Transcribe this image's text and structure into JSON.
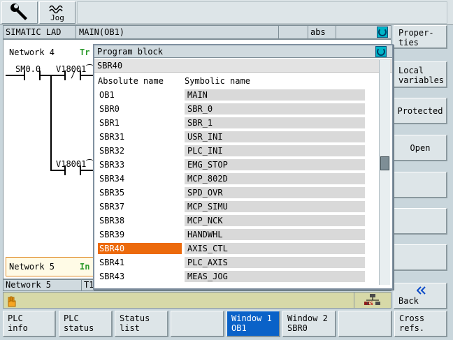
{
  "toolbar": {
    "tools_icon": "wrench-icon",
    "jog_icon": "jog-wave-icon",
    "jog_label": "Jog"
  },
  "header": {
    "left": "SIMATIC LAD",
    "program": "MAIN(OB1)",
    "mode": "abs"
  },
  "ladder": {
    "network4_label": "Network 4",
    "network4_trail": "Tr",
    "contact1": "SM0.0",
    "contact2": "V18001⁀",
    "contact3": "V18001⁀",
    "network5_label": "Network 5",
    "network5_trail": "In",
    "status_network": "Network 5",
    "status_trail": "T1"
  },
  "dialog": {
    "title": "Program block",
    "current": "SBR40",
    "col_absolute": "Absolute name",
    "col_symbolic": "Symbolic name",
    "rows": [
      {
        "abs": "OB1",
        "sym": "MAIN"
      },
      {
        "abs": "SBR0",
        "sym": "SBR_0"
      },
      {
        "abs": "SBR1",
        "sym": "SBR_1"
      },
      {
        "abs": "SBR31",
        "sym": "USR_INI"
      },
      {
        "abs": "SBR32",
        "sym": "PLC_INI"
      },
      {
        "abs": "SBR33",
        "sym": "EMG_STOP"
      },
      {
        "abs": "SBR34",
        "sym": "MCP_802D"
      },
      {
        "abs": "SBR35",
        "sym": "SPD_OVR"
      },
      {
        "abs": "SBR37",
        "sym": "MCP_SIMU"
      },
      {
        "abs": "SBR38",
        "sym": "MCP_NCK"
      },
      {
        "abs": "SBR39",
        "sym": "HANDWHL"
      },
      {
        "abs": "SBR40",
        "sym": "AXIS_CTL"
      },
      {
        "abs": "SBR41",
        "sym": "PLC_AXIS"
      },
      {
        "abs": "SBR43",
        "sym": "MEAS_JOG"
      }
    ],
    "selected_index": 11
  },
  "right_softkeys": {
    "properties": "Proper-\nties",
    "local_variables": "Local\nvariables",
    "protected": "Protected",
    "open": "Open",
    "back": "Back"
  },
  "bottom_softkeys": {
    "plc_info": "PLC\ninfo",
    "plc_status": "PLC\nstatus",
    "status_list": "Status\nlist",
    "window1": "Window 1\nOB1",
    "window2": "Window 2\nSBR0",
    "cross_refs": "Cross\nrefs."
  },
  "status_bar": {
    "rcs_label": "RCS"
  },
  "colors": {
    "background": "#c9d6dc",
    "selection": "#ec6a0c",
    "active_softkey": "#0a62c8",
    "refresh_icon": "#00b5c8"
  }
}
